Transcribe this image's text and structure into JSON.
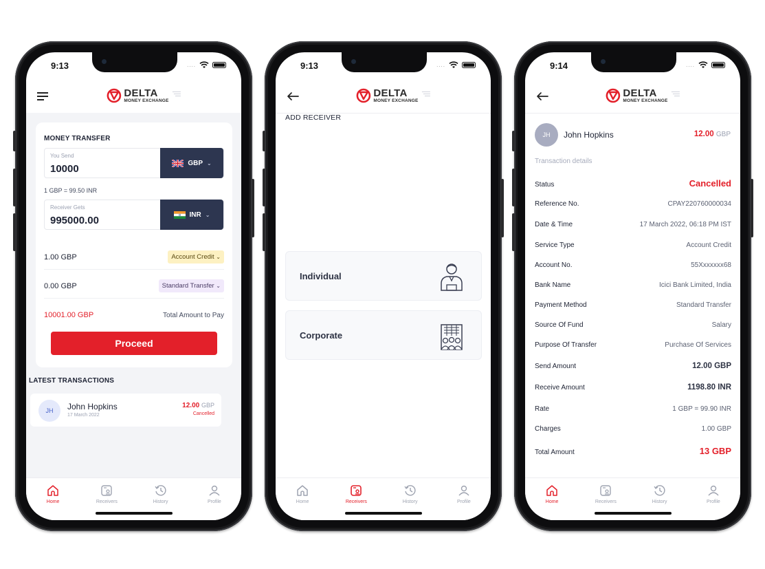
{
  "status_bar": {
    "screen1_time": "9:13",
    "screen2_time": "9:13",
    "screen3_time": "9:14"
  },
  "brand": {
    "name": "DELTA",
    "tagline": "MONEY EXCHANGE",
    "accent_color": "#e3202a",
    "dark_color": "#2d3650"
  },
  "bottom_nav": {
    "home": "Home",
    "receivers": "Receivers",
    "history": "History",
    "profile": "Profile"
  },
  "screen1": {
    "section_title": "MONEY TRANSFER",
    "send": {
      "label": "You Send",
      "value": "10000",
      "currency": "GBP"
    },
    "rate_text": "1 GBP  =  99.50 INR",
    "receive": {
      "label": "Receiver Gets",
      "value": "995000.00",
      "currency": "INR"
    },
    "fee_amount": "1.00 GBP",
    "fee_option": "Account Credit",
    "transfer_amount": "0.00 GBP",
    "transfer_option": "Standard Transfer",
    "total_amount": "10001.00 GBP",
    "total_label": "Total Amount to Pay",
    "proceed_label": "Proceed",
    "latest_title": "LATEST TRANSACTIONS",
    "txn": {
      "initials": "JH",
      "name": "John Hopkins",
      "date": "17 March 2022",
      "amount": "12.00",
      "currency": "GBP",
      "status": "Cancelled"
    }
  },
  "screen2": {
    "title": "ADD RECEIVER",
    "individual": "Individual",
    "corporate": "Corporate"
  },
  "screen3": {
    "initials": "JH",
    "name": "John Hopkins",
    "amount": "12.00",
    "currency": "GBP",
    "section": "Transaction details",
    "rows": [
      {
        "key": "Status",
        "value": "Cancelled"
      },
      {
        "key": "Reference No.",
        "value": "CPAY220760000034"
      },
      {
        "key": "Date & Time",
        "value": "17 March 2022, 06:18 PM IST"
      },
      {
        "key": "Service Type",
        "value": "Account Credit"
      },
      {
        "key": "Account No.",
        "value": "55Xxxxxxx68"
      },
      {
        "key": "Bank Name",
        "value": "Icici Bank Limited, India"
      },
      {
        "key": "Payment Method",
        "value": "Standard Transfer"
      },
      {
        "key": "Source Of Fund",
        "value": "Salary"
      },
      {
        "key": "Purpose Of Transfer",
        "value": "Purchase Of Services"
      },
      {
        "key": "Send Amount",
        "value": "12.00 GBP"
      },
      {
        "key": "Receive Amount",
        "value": "1198.80 INR"
      },
      {
        "key": "Rate",
        "value": "1 GBP = 99.90 INR"
      },
      {
        "key": "Charges",
        "value": "1.00 GBP"
      },
      {
        "key": "Total Amount",
        "value": "13 GBP"
      }
    ]
  }
}
